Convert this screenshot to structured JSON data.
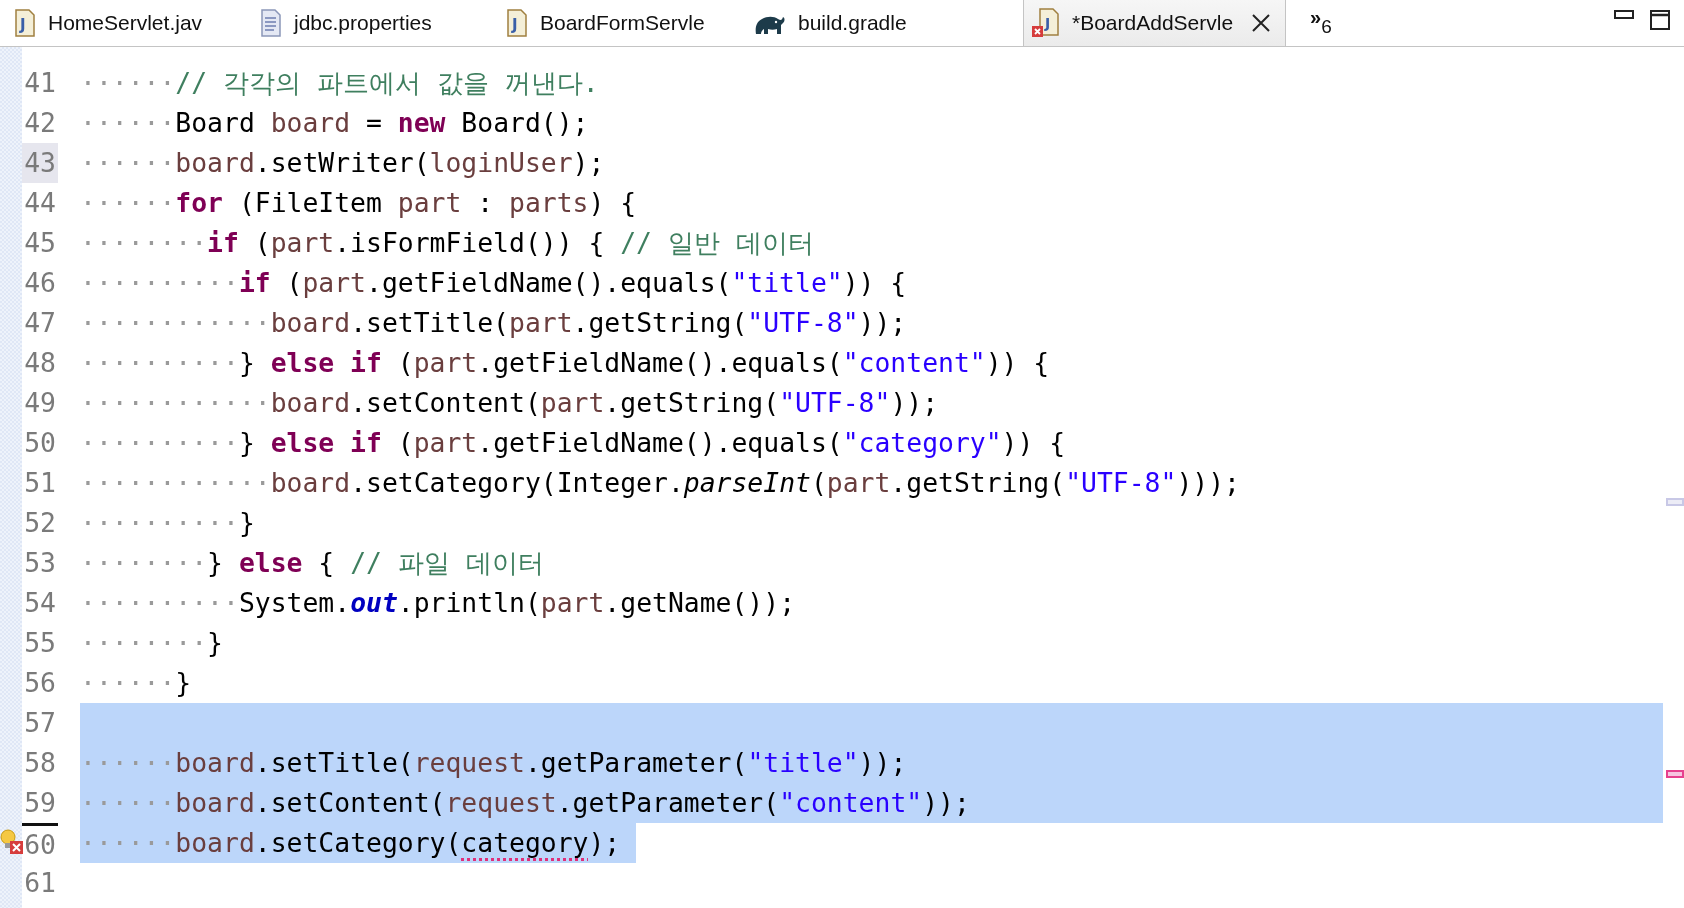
{
  "tabs": [
    {
      "label": "HomeServlet.jav",
      "icon_letter": "J",
      "selected": false,
      "closable": false
    },
    {
      "label": "jdbc.properties",
      "selected": false,
      "closable": false
    },
    {
      "label": "BoardFormServle",
      "icon_letter": "J",
      "selected": false,
      "closable": false
    },
    {
      "label": "build.gradle",
      "selected": false,
      "closable": false
    },
    {
      "label": "*BoardAddServle",
      "icon_letter": "J",
      "selected": true,
      "closable": true
    }
  ],
  "overflow": {
    "chevron": "»",
    "count": "6"
  },
  "editor": {
    "lines": [
      {
        "number": "41",
        "current": false,
        "selected": false,
        "error": false,
        "tokens": [
          {
            "text": "······",
            "kind": "ws"
          },
          {
            "text": "// 각각의 파트에서 값을 꺼낸다.",
            "kind": "comment"
          }
        ]
      },
      {
        "number": "42",
        "current": false,
        "selected": false,
        "error": false,
        "tokens": [
          {
            "text": "······",
            "kind": "ws"
          },
          {
            "text": "Board ",
            "kind": "plain"
          },
          {
            "text": "board",
            "kind": "var"
          },
          {
            "text": " = ",
            "kind": "plain"
          },
          {
            "text": "new",
            "kind": "keyword"
          },
          {
            "text": " Board();",
            "kind": "plain"
          }
        ]
      },
      {
        "number": "43",
        "current": true,
        "selected": false,
        "error": false,
        "tokens": [
          {
            "text": "······",
            "kind": "ws"
          },
          {
            "text": "board",
            "kind": "var"
          },
          {
            "text": ".setWriter(",
            "kind": "plain"
          },
          {
            "text": "loginUser",
            "kind": "var"
          },
          {
            "text": ");",
            "kind": "plain"
          }
        ]
      },
      {
        "number": "44",
        "current": false,
        "selected": false,
        "error": false,
        "tokens": [
          {
            "text": "······",
            "kind": "ws"
          },
          {
            "text": "for",
            "kind": "keyword"
          },
          {
            "text": " (FileItem ",
            "kind": "plain"
          },
          {
            "text": "part",
            "kind": "var"
          },
          {
            "text": " : ",
            "kind": "plain"
          },
          {
            "text": "parts",
            "kind": "var"
          },
          {
            "text": ") {",
            "kind": "plain"
          }
        ]
      },
      {
        "number": "45",
        "current": false,
        "selected": false,
        "error": false,
        "tokens": [
          {
            "text": "········",
            "kind": "ws"
          },
          {
            "text": "if",
            "kind": "keyword"
          },
          {
            "text": " (",
            "kind": "plain"
          },
          {
            "text": "part",
            "kind": "var"
          },
          {
            "text": ".isFormField()) { ",
            "kind": "plain"
          },
          {
            "text": "// 일반 데이터",
            "kind": "comment"
          }
        ]
      },
      {
        "number": "46",
        "current": false,
        "selected": false,
        "error": false,
        "tokens": [
          {
            "text": "··········",
            "kind": "ws"
          },
          {
            "text": "if",
            "kind": "keyword"
          },
          {
            "text": " (",
            "kind": "plain"
          },
          {
            "text": "part",
            "kind": "var"
          },
          {
            "text": ".getFieldName().equals(",
            "kind": "plain"
          },
          {
            "text": "\"title\"",
            "kind": "string"
          },
          {
            "text": ")) {",
            "kind": "plain"
          }
        ]
      },
      {
        "number": "47",
        "current": false,
        "selected": false,
        "error": false,
        "tokens": [
          {
            "text": "············",
            "kind": "ws"
          },
          {
            "text": "board",
            "kind": "var"
          },
          {
            "text": ".setTitle(",
            "kind": "plain"
          },
          {
            "text": "part",
            "kind": "var"
          },
          {
            "text": ".getString(",
            "kind": "plain"
          },
          {
            "text": "\"UTF-8\"",
            "kind": "string"
          },
          {
            "text": "));",
            "kind": "plain"
          }
        ]
      },
      {
        "number": "48",
        "current": false,
        "selected": false,
        "error": false,
        "tokens": [
          {
            "text": "··········",
            "kind": "ws"
          },
          {
            "text": "} ",
            "kind": "plain"
          },
          {
            "text": "else if",
            "kind": "keyword"
          },
          {
            "text": " (",
            "kind": "plain"
          },
          {
            "text": "part",
            "kind": "var"
          },
          {
            "text": ".getFieldName().equals(",
            "kind": "plain"
          },
          {
            "text": "\"content\"",
            "kind": "string"
          },
          {
            "text": ")) {",
            "kind": "plain"
          }
        ]
      },
      {
        "number": "49",
        "current": false,
        "selected": false,
        "error": false,
        "tokens": [
          {
            "text": "············",
            "kind": "ws"
          },
          {
            "text": "board",
            "kind": "var"
          },
          {
            "text": ".setContent(",
            "kind": "plain"
          },
          {
            "text": "part",
            "kind": "var"
          },
          {
            "text": ".getString(",
            "kind": "plain"
          },
          {
            "text": "\"UTF-8\"",
            "kind": "string"
          },
          {
            "text": "));",
            "kind": "plain"
          }
        ]
      },
      {
        "number": "50",
        "current": false,
        "selected": false,
        "error": false,
        "tokens": [
          {
            "text": "··········",
            "kind": "ws"
          },
          {
            "text": "} ",
            "kind": "plain"
          },
          {
            "text": "else if",
            "kind": "keyword"
          },
          {
            "text": " (",
            "kind": "plain"
          },
          {
            "text": "part",
            "kind": "var"
          },
          {
            "text": ".getFieldName().equals(",
            "kind": "plain"
          },
          {
            "text": "\"category\"",
            "kind": "string"
          },
          {
            "text": ")) {",
            "kind": "plain"
          }
        ]
      },
      {
        "number": "51",
        "current": false,
        "selected": false,
        "error": false,
        "tokens": [
          {
            "text": "············",
            "kind": "ws"
          },
          {
            "text": "board",
            "kind": "var"
          },
          {
            "text": ".setCategory(Integer.",
            "kind": "plain"
          },
          {
            "text": "parseInt",
            "kind": "static-method"
          },
          {
            "text": "(",
            "kind": "plain"
          },
          {
            "text": "part",
            "kind": "var"
          },
          {
            "text": ".getString(",
            "kind": "plain"
          },
          {
            "text": "\"UTF-8\"",
            "kind": "string"
          },
          {
            "text": ")));",
            "kind": "plain"
          }
        ]
      },
      {
        "number": "52",
        "current": false,
        "selected": false,
        "error": false,
        "tokens": [
          {
            "text": "··········",
            "kind": "ws"
          },
          {
            "text": "}",
            "kind": "plain"
          }
        ]
      },
      {
        "number": "53",
        "current": false,
        "selected": false,
        "error": false,
        "tokens": [
          {
            "text": "········",
            "kind": "ws"
          },
          {
            "text": "} ",
            "kind": "plain"
          },
          {
            "text": "else",
            "kind": "keyword"
          },
          {
            "text": " { ",
            "kind": "plain"
          },
          {
            "text": "// 파일 데이터",
            "kind": "comment"
          }
        ]
      },
      {
        "number": "54",
        "current": false,
        "selected": false,
        "error": false,
        "tokens": [
          {
            "text": "··········",
            "kind": "ws"
          },
          {
            "text": "System.",
            "kind": "plain"
          },
          {
            "text": "out",
            "kind": "static-field"
          },
          {
            "text": ".println(",
            "kind": "plain"
          },
          {
            "text": "part",
            "kind": "var"
          },
          {
            "text": ".getName());",
            "kind": "plain"
          }
        ]
      },
      {
        "number": "55",
        "current": false,
        "selected": false,
        "error": false,
        "tokens": [
          {
            "text": "········",
            "kind": "ws"
          },
          {
            "text": "}",
            "kind": "plain"
          }
        ]
      },
      {
        "number": "56",
        "current": false,
        "selected": false,
        "error": false,
        "tokens": [
          {
            "text": "······",
            "kind": "ws"
          },
          {
            "text": "}",
            "kind": "plain"
          }
        ]
      },
      {
        "number": "57",
        "current": false,
        "selected": true,
        "error": false
      },
      {
        "number": "58",
        "current": false,
        "selected": true,
        "error": false,
        "tokens": [
          {
            "text": "······",
            "kind": "ws"
          },
          {
            "text": "board",
            "kind": "var"
          },
          {
            "text": ".setTitle(",
            "kind": "plain"
          },
          {
            "text": "request",
            "kind": "var"
          },
          {
            "text": ".getParameter(",
            "kind": "plain"
          },
          {
            "text": "\"title\"",
            "kind": "string"
          },
          {
            "text": "));",
            "kind": "plain"
          }
        ]
      },
      {
        "number": "59",
        "current": false,
        "selected": true,
        "error": false,
        "tokens": [
          {
            "text": "······",
            "kind": "ws"
          },
          {
            "text": "board",
            "kind": "var"
          },
          {
            "text": ".setContent(",
            "kind": "plain"
          },
          {
            "text": "request",
            "kind": "var"
          },
          {
            "text": ".getParameter(",
            "kind": "plain"
          },
          {
            "text": "\"content\"",
            "kind": "string"
          },
          {
            "text": "));",
            "kind": "plain"
          }
        ]
      },
      {
        "number": "60",
        "current": false,
        "selected": true,
        "error": true,
        "tokens": [
          {
            "text": "······",
            "kind": "ws"
          },
          {
            "text": "board",
            "kind": "var"
          },
          {
            "text": ".setCategory(",
            "kind": "plain"
          },
          {
            "text": "category",
            "kind": "plain",
            "error": true
          },
          {
            "text": ");",
            "kind": "plain"
          }
        ]
      },
      {
        "number": "61",
        "current": false,
        "selected": false,
        "error": false
      }
    ],
    "overview_marks": [
      {
        "kind": "occurrence"
      },
      {
        "kind": "error"
      }
    ]
  }
}
